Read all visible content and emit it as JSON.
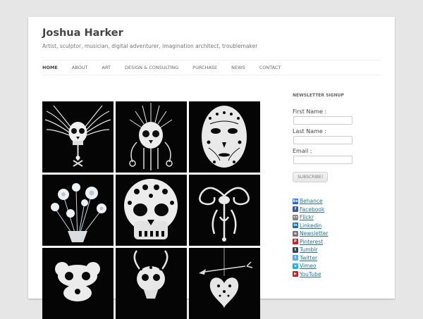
{
  "site": {
    "title": "Joshua Harker",
    "tagline": "Artist, sculptor, musician, digital adventurer, imagination architect, troublemaker"
  },
  "nav": {
    "items": [
      {
        "id": "home",
        "label": "HOME"
      },
      {
        "id": "about",
        "label": "ABOUT"
      },
      {
        "id": "art",
        "label": "ART"
      },
      {
        "id": "design",
        "label": "DESIGN & CONSULTING"
      },
      {
        "id": "purchase",
        "label": "PURCHASE"
      },
      {
        "id": "news",
        "label": "NEWS"
      },
      {
        "id": "contact",
        "label": "CONTACT"
      }
    ],
    "current": "HOME"
  },
  "gallery": {
    "items": [
      {
        "subject": "winged skull sculpture"
      },
      {
        "subject": "ornate crown skull sculpture"
      },
      {
        "subject": "filigree mask sculpture"
      },
      {
        "subject": "flower bouquet sculpture"
      },
      {
        "subject": "lattice skull sculpture"
      },
      {
        "subject": "ornamental pendant sculpture"
      },
      {
        "subject": "swirl skull sculpture"
      },
      {
        "subject": "horned skull sculpture"
      },
      {
        "subject": "pierced heart sculpture"
      }
    ]
  },
  "sidebar": {
    "newsletter_title": "NEWSLETTER SIGNUP",
    "first_name_label": "First Name :",
    "last_name_label": "Last Name :",
    "email_label": "Email :",
    "subscribe_label": "SUBSCRIBE!",
    "links": [
      {
        "label": "Behance",
        "icon": "behance-icon",
        "color": "#1769ff",
        "glyph": "Bē"
      },
      {
        "label": "Facebook",
        "icon": "facebook-icon",
        "color": "#3b5998",
        "glyph": "f"
      },
      {
        "label": "Flickr",
        "icon": "flickr-icon",
        "color": "#888888",
        "glyph": "••"
      },
      {
        "label": "Linkedin",
        "icon": "linkedin-icon",
        "color": "#0e76a8",
        "glyph": "in"
      },
      {
        "label": "Newsletter",
        "icon": "newsletter-icon",
        "color": "#777777",
        "glyph": "≡"
      },
      {
        "label": "Pinterest",
        "icon": "pinterest-icon",
        "color": "#cb2027",
        "glyph": "P"
      },
      {
        "label": "Tumblr",
        "icon": "tumblr-icon",
        "color": "#35465c",
        "glyph": "t"
      },
      {
        "label": "Twitter",
        "icon": "twitter-icon",
        "color": "#55acee",
        "glyph": "t"
      },
      {
        "label": "Vimeo",
        "icon": "vimeo-icon",
        "color": "#1ab7ea",
        "glyph": "v"
      },
      {
        "label": "YouTube",
        "icon": "youtube-icon",
        "color": "#cd201f",
        "glyph": "▶"
      }
    ]
  }
}
